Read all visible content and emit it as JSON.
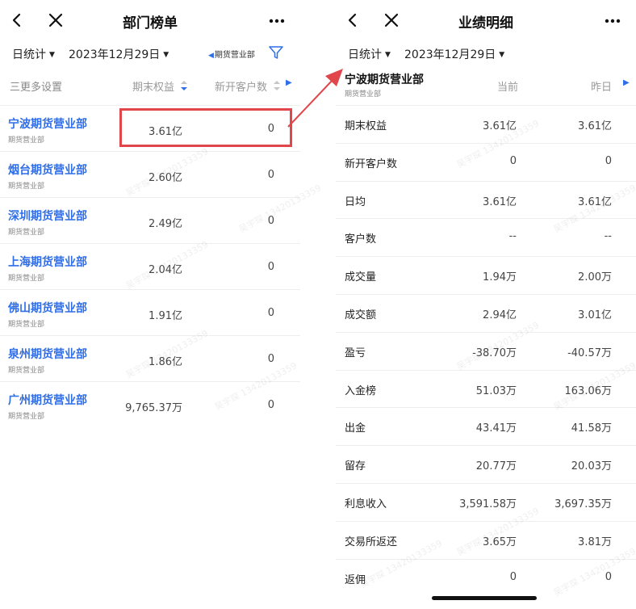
{
  "left": {
    "title": "部门榜单",
    "filter": {
      "stat_label": "日统计",
      "date_label": "2023年12月29日",
      "dept_label": "期货营业部"
    },
    "columns": {
      "settings": "三更多设置",
      "equity": "期末权益",
      "new_customers": "新开客户数"
    },
    "rows": [
      {
        "name": "宁波期货营业部",
        "sub": "期货营业部",
        "equity": "3.61亿",
        "new_customers": "0"
      },
      {
        "name": "烟台期货营业部",
        "sub": "期货营业部",
        "equity": "2.60亿",
        "new_customers": "0"
      },
      {
        "name": "深圳期货营业部",
        "sub": "期货营业部",
        "equity": "2.49亿",
        "new_customers": "0"
      },
      {
        "name": "上海期货营业部",
        "sub": "期货营业部",
        "equity": "2.04亿",
        "new_customers": "0"
      },
      {
        "name": "佛山期货营业部",
        "sub": "期货营业部",
        "equity": "1.91亿",
        "new_customers": "0"
      },
      {
        "name": "泉州期货营业部",
        "sub": "期货营业部",
        "equity": "1.86亿",
        "new_customers": "0"
      },
      {
        "name": "广州期货营业部",
        "sub": "期货营业部",
        "equity": "9,765.37万",
        "new_customers": "0"
      }
    ]
  },
  "right": {
    "title": "业绩明细",
    "filter": {
      "stat_label": "日统计",
      "date_label": "2023年12月29日"
    },
    "dept_name": "宁波期货营业部",
    "dept_sub": "期货营业部",
    "col_current": "当前",
    "col_previous": "昨日",
    "metrics": [
      {
        "label": "期末权益",
        "current": "3.61亿",
        "previous": "3.61亿"
      },
      {
        "label": "新开客户数",
        "current": "0",
        "previous": "0"
      },
      {
        "label": "日均",
        "current": "3.61亿",
        "previous": "3.61亿"
      },
      {
        "label": "客户数",
        "current": "--",
        "previous": "--"
      },
      {
        "label": "成交量",
        "current": "1.94万",
        "previous": "2.00万"
      },
      {
        "label": "成交额",
        "current": "2.94亿",
        "previous": "3.01亿"
      },
      {
        "label": "盈亏",
        "current": "-38.70万",
        "previous": "-40.57万"
      },
      {
        "label": "入金榜",
        "current": "51.03万",
        "previous": "163.06万"
      },
      {
        "label": "出金",
        "current": "43.41万",
        "previous": "41.58万"
      },
      {
        "label": "留存",
        "current": "20.77万",
        "previous": "20.03万"
      },
      {
        "label": "利息收入",
        "current": "3,591.58万",
        "previous": "3,697.35万"
      },
      {
        "label": "交易所返还",
        "current": "3.65万",
        "previous": "3.81万"
      },
      {
        "label": "返佣",
        "current": "0",
        "previous": "0"
      }
    ]
  },
  "watermark": "吴宇琛 13420133359",
  "colors": {
    "accent": "#2f6ee8",
    "highlight": "#e0464a",
    "divider": "#eeeeee"
  }
}
